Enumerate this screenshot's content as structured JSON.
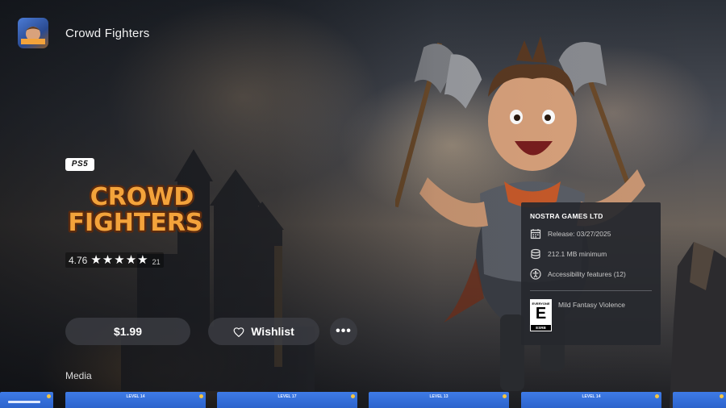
{
  "header": {
    "title": "Crowd Fighters"
  },
  "game": {
    "platform_badge": "PS5",
    "logo_line1": "CROWD",
    "logo_line2": "FIGHTERS",
    "rating_score": "4.76",
    "rating_stars": "★★★★★",
    "rating_count": "21",
    "stars_value": 5
  },
  "actions": {
    "price": "$1.99",
    "wishlist": "Wishlist",
    "more": "•••"
  },
  "media": {
    "label": "Media",
    "thumbnails": [
      "LEVEL 14",
      "LEVEL 17",
      "LEVEL 13",
      "LEVEL 14"
    ]
  },
  "info": {
    "publisher": "NOSTRA GAMES LTD",
    "release": "Release: 03/27/2025",
    "size": "212.1 MB minimum",
    "accessibility": "Accessibility features (12)",
    "esrb_top": "EVERYONE",
    "esrb_letter": "E",
    "esrb_bottom": "ESRB",
    "descriptor": "Mild Fantasy Violence"
  },
  "colors": {
    "logo_fill": "#f3a33b",
    "logo_outline": "#5a2a0e",
    "thumb_blue": "#3e7be6"
  },
  "icons": {
    "platform": "ps5-logo",
    "wishlist": "heart-icon",
    "more": "ellipsis-icon",
    "release": "calendar-icon",
    "size": "storage-icon",
    "accessibility": "accessibility-icon"
  }
}
